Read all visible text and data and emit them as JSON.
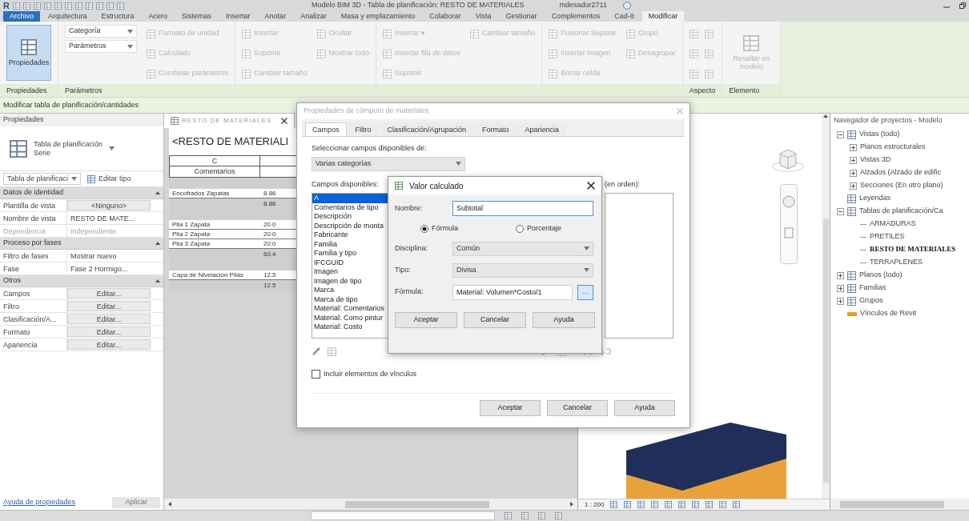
{
  "title_bar": {
    "logo": "R",
    "title": "Modelo BIM 3D - Tabla de planificación: RESTO DE MATERIALES",
    "user": "mdesador2711"
  },
  "menu_tabs": [
    {
      "label": "Archivo",
      "kind": "file",
      "selected": false
    },
    {
      "label": "Arquitectura",
      "kind": "tab",
      "selected": false
    },
    {
      "label": "Estructura",
      "kind": "tab",
      "selected": false
    },
    {
      "label": "Acero",
      "kind": "tab",
      "selected": false
    },
    {
      "label": "Sistemas",
      "kind": "tab",
      "selected": false
    },
    {
      "label": "Insertar",
      "kind": "tab",
      "selected": false
    },
    {
      "label": "Anotar",
      "kind": "tab",
      "selected": false
    },
    {
      "label": "Analizar",
      "kind": "tab",
      "selected": false
    },
    {
      "label": "Masa y emplazamiento",
      "kind": "tab",
      "selected": false
    },
    {
      "label": "Colaborar",
      "kind": "tab",
      "selected": false
    },
    {
      "label": "Vista",
      "kind": "tab",
      "selected": false
    },
    {
      "label": "Gestionar",
      "kind": "tab",
      "selected": false
    },
    {
      "label": "Complementos",
      "kind": "tab",
      "selected": false
    },
    {
      "label": "Cad-It",
      "kind": "tab",
      "selected": false
    },
    {
      "label": "Modificar",
      "kind": "tab",
      "selected": true
    }
  ],
  "ribbon": {
    "panels": [
      {
        "label": "Propiedades",
        "columns": [
          [
            {
              "kind": "large",
              "label": "Propiedades",
              "disabled": false
            }
          ]
        ]
      },
      {
        "label": "Parámetros",
        "columns": [
          [
            {
              "kind": "dropdown",
              "label": "Categoría",
              "disabled": false
            },
            {
              "kind": "dropdown",
              "label": "Parámetros",
              "disabled": false
            }
          ],
          [
            {
              "kind": "command",
              "label": "Formato de unidad",
              "disabled": true
            },
            {
              "kind": "command",
              "label": "Calculado",
              "disabled": true
            },
            {
              "kind": "command",
              "label": "Combinar parámetros",
              "disabled": true
            }
          ]
        ]
      },
      {
        "columns": [
          [
            {
              "kind": "command",
              "label": "Insertar",
              "disabled": true
            },
            {
              "kind": "command",
              "label": "Suprimir",
              "disabled": true
            },
            {
              "kind": "command",
              "label": "Cambiar tamaño",
              "disabled": true
            }
          ],
          [
            {
              "kind": "command",
              "label": "Ocultar",
              "disabled": true
            },
            {
              "kind": "command",
              "label": "Mostrar todo",
              "disabled": true
            }
          ]
        ]
      },
      {
        "columns": [
          [
            {
              "kind": "command",
              "label": "Insertar ▾",
              "disabled": true
            },
            {
              "kind": "command",
              "label": "Insertar fila de datos",
              "disabled": true
            },
            {
              "kind": "command",
              "label": "Suprimir",
              "disabled": true
            }
          ],
          [
            {
              "kind": "command",
              "label": "Cambiar tamaño",
              "disabled": true
            }
          ]
        ]
      },
      {
        "columns": [
          [
            {
              "kind": "command",
              "label": "Fusionar Separar",
              "disabled": true
            },
            {
              "kind": "command",
              "label": "Insertar imagen",
              "disabled": true
            },
            {
              "kind": "command",
              "label": "Borrar celda",
              "disabled": true
            }
          ],
          [
            {
              "kind": "command",
              "label": "Grupo",
              "disabled": true
            },
            {
              "kind": "command",
              "label": "Desagrupar",
              "disabled": true
            }
          ]
        ]
      },
      {
        "label": "Aspecto",
        "columns": [
          [
            {
              "kind": "icons",
              "disabled": true
            },
            {
              "kind": "icons",
              "disabled": true
            },
            {
              "kind": "icons",
              "disabled": true
            }
          ]
        ]
      },
      {
        "label": "Elemento",
        "columns": [
          [
            {
              "kind": "large",
              "label": "Resaltar en modelo",
              "disabled": true
            }
          ]
        ]
      }
    ]
  },
  "context_bar": "Modificar tabla de planificación/cantidades",
  "properties": {
    "title": "Propiedades",
    "type_name": "Tabla de planificación",
    "type_sub": "Serie",
    "filter": "Tabla de planificaci",
    "edit_type": "Editar tipo",
    "groups": [
      {
        "label": "Datos de identidad",
        "rows": [
          {
            "kind": "button",
            "name": "Plantilla de vista",
            "value": "<Ninguno>",
            "disabled": false
          },
          {
            "kind": "text",
            "name": "Nombre de vista",
            "value": "RESTO DE MATE...",
            "disabled": false
          },
          {
            "kind": "text",
            "name": "Dependencia",
            "value": "Independiente",
            "disabled": true
          }
        ]
      },
      {
        "label": "Proceso por fases",
        "rows": [
          {
            "kind": "text",
            "name": "Filtro de fases",
            "value": "Mostrar nuevo",
            "disabled": false
          },
          {
            "kind": "text",
            "name": "Fase",
            "value": "Fase 2 Hormigo...",
            "disabled": false
          }
        ]
      },
      {
        "label": "Otros",
        "rows": [
          {
            "kind": "button",
            "name": "Campos",
            "value": "Editar...",
            "disabled": false
          },
          {
            "kind": "button",
            "name": "Filtro",
            "value": "Editar...",
            "disabled": false
          },
          {
            "kind": "button",
            "name": "Clasificación/A...",
            "value": "Editar...",
            "disabled": false
          },
          {
            "kind": "button",
            "name": "Formato",
            "value": "Editar...",
            "disabled": false
          },
          {
            "kind": "button",
            "name": "Apariencia",
            "value": "Editar...",
            "disabled": false
          }
        ]
      }
    ],
    "help_link": "Ayuda de propiedades",
    "apply": "Aplicar"
  },
  "schedule": {
    "tab": "RESTO DE MATERIALES",
    "title": "<RESTO DE MATERIALI",
    "column_letter": "C",
    "column_heading": "Comentarios",
    "rows": [
      {
        "kind": "gap"
      },
      {
        "kind": "data",
        "name": "Encofrados Zapatas",
        "value": "8.86"
      },
      {
        "kind": "subtotal",
        "value": "8.86"
      },
      {
        "kind": "gap"
      },
      {
        "kind": "data",
        "name": "Pila 1 Zapata",
        "value": "20.0"
      },
      {
        "kind": "data",
        "name": "Pila 2 Zapata",
        "value": "20.0"
      },
      {
        "kind": "data",
        "name": "Pila 3 Zapata",
        "value": "20.0"
      },
      {
        "kind": "subtotal",
        "value": "60.4"
      },
      {
        "kind": "gap"
      },
      {
        "kind": "data",
        "name": "Capa de Nivelación Pilas",
        "value": "12.5"
      },
      {
        "kind": "subtotal",
        "value": "12.5"
      }
    ]
  },
  "view3d": {
    "scale": "1 : 200"
  },
  "project_browser": {
    "title": "Navegador de proyectos - Modelo",
    "tree": [
      {
        "label": "Vistas (todo)",
        "kind": "views",
        "expanded": true,
        "selected": false,
        "children": [
          {
            "label": "Planos estructurales",
            "kind": "branch",
            "expanded": false,
            "selected": false
          },
          {
            "label": "Vistas 3D",
            "kind": "branch",
            "expanded": false,
            "selected": false
          },
          {
            "label": "Alzados (Alzado de edific",
            "kind": "branch",
            "expanded": false,
            "selected": false
          },
          {
            "label": "Secciones (En otro plano)",
            "kind": "branch",
            "expanded": false,
            "selected": false
          }
        ]
      },
      {
        "label": "Leyendas",
        "kind": "legend",
        "selected": false
      },
      {
        "label": "Tablas de planificación/Ca",
        "kind": "schedule",
        "expanded": true,
        "selected": false,
        "children": [
          {
            "label": "ARMADURAS",
            "kind": "leaf",
            "selected": false
          },
          {
            "label": "PRETILES",
            "kind": "leaf",
            "selected": false
          },
          {
            "label": "RESTO DE MATERIALES",
            "kind": "leaf",
            "selected": true
          },
          {
            "label": "TERRAPLENES",
            "kind": "leaf",
            "selected": false
          }
        ]
      },
      {
        "label": "Planos (todo)",
        "kind": "sheets",
        "expanded": false,
        "selected": false
      },
      {
        "label": "Familias",
        "kind": "families",
        "expanded": false,
        "selected": false
      },
      {
        "label": "Grupos",
        "kind": "groups",
        "expanded": false,
        "selected": false
      },
      {
        "label": "Vínculos de Revit",
        "kind": "links",
        "selected": false
      }
    ]
  },
  "dialog": {
    "title": "Propiedades de cómputo de materiales",
    "tabs": [
      {
        "label": "Campos",
        "selected": true
      },
      {
        "label": "Filtro",
        "selected": false
      },
      {
        "label": "Clasificación/Agrupación",
        "selected": false
      },
      {
        "label": "Formato",
        "selected": false
      },
      {
        "label": "Apariencia",
        "selected": false
      }
    ],
    "source_label": "Seleccionar campos disponibles de:",
    "source_value": "Varias categorías",
    "available_label": "Campos disponibles:",
    "available_fields": [
      {
        "label": "A",
        "selected": true
      },
      {
        "label": "Comentarios de tipo",
        "selected": false
      },
      {
        "label": "Descripción",
        "selected": false
      },
      {
        "label": "Descripción de monta",
        "selected": false
      },
      {
        "label": "Fabricante",
        "selected": false
      },
      {
        "label": "Familia",
        "selected": false
      },
      {
        "label": "Familia y tipo",
        "selected": false
      },
      {
        "label": "IFCGUID",
        "selected": false
      },
      {
        "label": "Imagen",
        "selected": false
      },
      {
        "label": "Imagen de tipo",
        "selected": false
      },
      {
        "label": "Marca",
        "selected": false
      },
      {
        "label": "Marca de tipo",
        "selected": false
      },
      {
        "label": "Material: Comentarios",
        "selected": false
      },
      {
        "label": "Material: Como pintur",
        "selected": false
      },
      {
        "label": "Material: Costo",
        "selected": false
      }
    ],
    "scheduled_label": "(en orden):",
    "include_links": {
      "label": "Incluir elementos de vínculos",
      "checked": false
    },
    "buttons": [
      "Aceptar",
      "Cancelar",
      "Ayuda"
    ]
  },
  "calc_dialog": {
    "title": "Valor calculado",
    "name_label": "Nombre:",
    "name_value": "Subtotal",
    "modes": [
      {
        "label": "Fórmula",
        "selected": true
      },
      {
        "label": "Porcentaje",
        "selected": false
      }
    ],
    "discipline_label": "Disciplina:",
    "discipline_value": "Común",
    "type_label": "Tipo:",
    "type_value": "Divisa",
    "formula_label": "Fórmula:",
    "formula_value": "Material: Volumen*Costo/1",
    "formula_button": "...",
    "buttons": [
      "Aceptar",
      "Cancelar",
      "Ayuda"
    ]
  }
}
